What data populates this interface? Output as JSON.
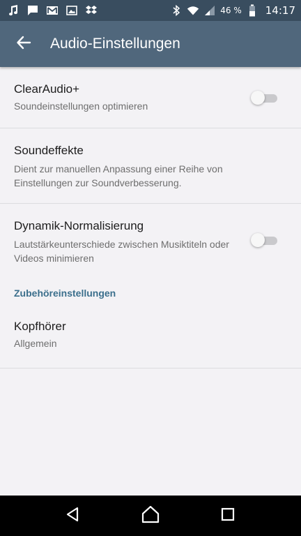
{
  "status_bar": {
    "battery_percent": "46 %",
    "time": "14:17",
    "icons": [
      "music-note-icon",
      "message-icon",
      "gmail-icon",
      "image-icon",
      "dropbox-icon",
      "bluetooth-icon",
      "wifi-icon",
      "signal-icon",
      "battery-icon"
    ]
  },
  "toolbar": {
    "title": "Audio-Einstellungen",
    "back_icon": "arrow-back-icon"
  },
  "preferences": [
    {
      "title": "ClearAudio+",
      "summary": "Soundeinstellungen optimieren",
      "has_toggle": true,
      "toggle_on": false
    },
    {
      "title": "Soundeffekte",
      "summary": "Dient zur manuellen Anpassung einer Reihe von Einstellungen zur Soundverbesserung.",
      "has_toggle": false
    },
    {
      "title": "Dynamik-Normalisierung",
      "summary": "Lautstärkeunterschiede zwischen Musiktiteln oder Videos minimieren",
      "has_toggle": true,
      "toggle_on": false
    }
  ],
  "accessory_section": {
    "header": "Zubehöreinstellungen",
    "items": [
      {
        "title": "Kopfhörer",
        "summary": "Allgemein"
      }
    ]
  },
  "nav_bar": {
    "buttons": [
      "back-triangle-icon",
      "home-circle-icon",
      "recents-square-icon"
    ]
  },
  "colors": {
    "status_bar": "#394d5f",
    "toolbar": "#50677c",
    "background": "#f3f2f5",
    "section_header": "#3b6f8c"
  }
}
